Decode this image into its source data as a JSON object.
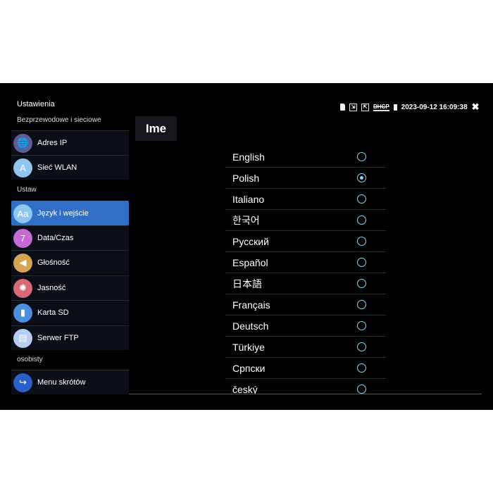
{
  "header": {
    "title": "Ustawienia",
    "page_title": "Ime",
    "datetime": "2023-09-12 16:09:38",
    "status_icons": [
      "sd-card-icon",
      "screen-icon-1",
      "screen-icon-2",
      "dhcp-off-icon",
      "battery-icon"
    ],
    "dhcp_label": "DHCP"
  },
  "sidebar": {
    "sections": [
      "Bezprzewodowe i sieciowe",
      "Ustaw",
      "osobisty"
    ],
    "items": [
      {
        "label": "Adres IP",
        "icon": "globe-icon",
        "color": "#5a5f9a"
      },
      {
        "label": "Sieć WLAN",
        "icon": "antenna-icon",
        "color": "#8fc6ee"
      },
      {
        "label": "Język i wejście",
        "icon": "language-icon",
        "color": "#8fc6ee",
        "selected": true
      },
      {
        "label": "Data/Czas",
        "icon": "calendar-icon",
        "color": "#c56ad8"
      },
      {
        "label": "Głośność",
        "icon": "speaker-icon",
        "color": "#d7a452"
      },
      {
        "label": "Jasność",
        "icon": "bulb-icon",
        "color": "#d96a74"
      },
      {
        "label": "Karta SD",
        "icon": "sd-card-icon",
        "color": "#4a8fe0"
      },
      {
        "label": "Serwer FTP",
        "icon": "ftp-icon",
        "color": "#b7cdef"
      },
      {
        "label": "Menu skrótów",
        "icon": "shortcut-icon",
        "color": "#2b5fc8"
      }
    ]
  },
  "languages": [
    {
      "label": "English",
      "selected": false
    },
    {
      "label": "Polish",
      "selected": true
    },
    {
      "label": "Italiano",
      "selected": false
    },
    {
      "label": "한국어",
      "selected": false
    },
    {
      "label": "Русский",
      "selected": false
    },
    {
      "label": "Español",
      "selected": false
    },
    {
      "label": "日本語",
      "selected": false
    },
    {
      "label": "Français",
      "selected": false
    },
    {
      "label": "Deutsch",
      "selected": false
    },
    {
      "label": "Türkiye",
      "selected": false
    },
    {
      "label": "Српски",
      "selected": false
    },
    {
      "label": "český",
      "selected": false
    }
  ]
}
